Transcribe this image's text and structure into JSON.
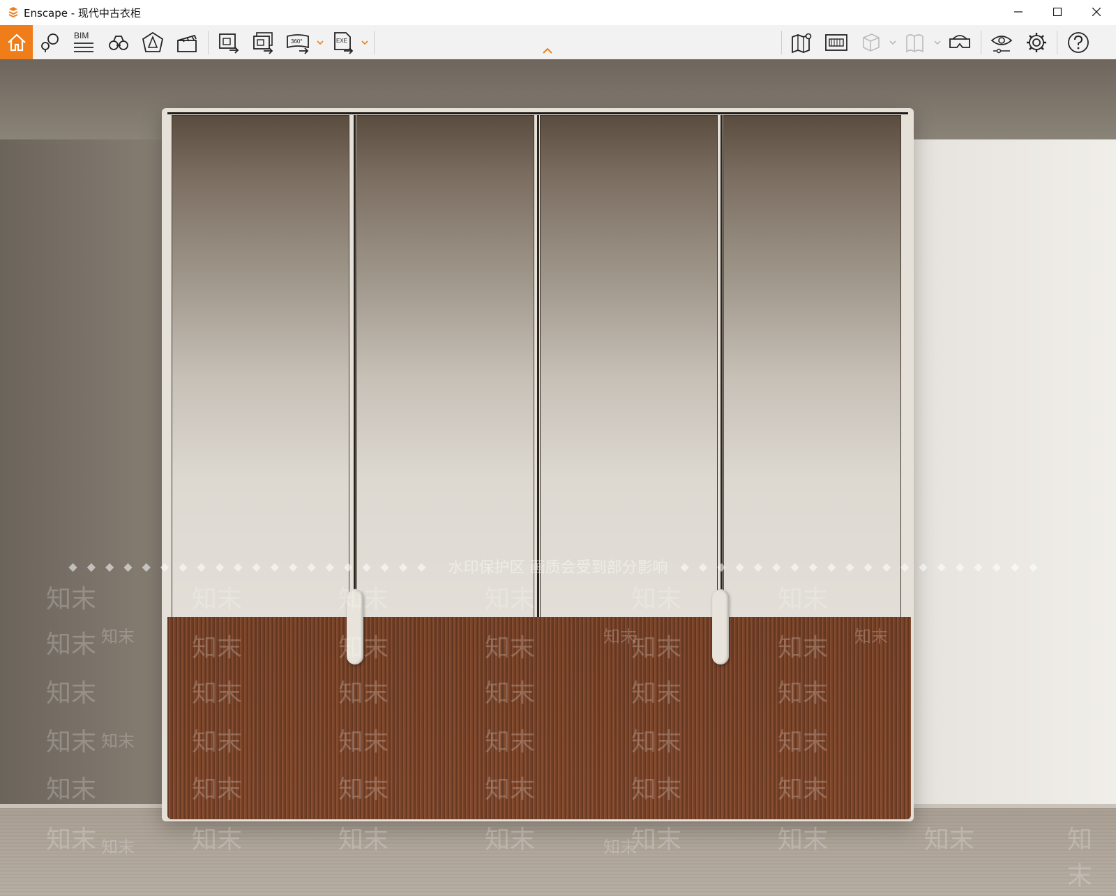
{
  "window": {
    "title": "Enscape - 现代中古衣柜",
    "controls": [
      "minimize",
      "maximize",
      "close"
    ]
  },
  "toolbar": {
    "left": [
      {
        "id": "home",
        "icon": "home-icon",
        "active": true
      },
      {
        "id": "views",
        "icon": "views-icon"
      },
      {
        "id": "bim",
        "icon": "bim-icon",
        "label": "BIM"
      },
      {
        "id": "binoculars",
        "icon": "binoculars-icon"
      },
      {
        "id": "asset-library",
        "icon": "asset-library-icon"
      },
      {
        "id": "video-editor",
        "icon": "clapper-icon"
      },
      {
        "id": "screenshot",
        "icon": "screenshot-icon"
      },
      {
        "id": "batch-render",
        "icon": "batch-render-icon"
      },
      {
        "id": "panorama",
        "icon": "panorama-icon",
        "label": "360°"
      },
      {
        "id": "export-exe",
        "icon": "export-exe-icon",
        "label": "EXE"
      }
    ],
    "right": [
      {
        "id": "map",
        "icon": "map-icon"
      },
      {
        "id": "batch",
        "icon": "batch-icon"
      },
      {
        "id": "cube",
        "icon": "cube-icon",
        "disabled": true
      },
      {
        "id": "book",
        "icon": "book-icon",
        "disabled": true
      },
      {
        "id": "vr",
        "icon": "vr-headset-icon"
      },
      {
        "id": "visual-settings",
        "icon": "eye-settings-icon"
      },
      {
        "id": "settings",
        "icon": "gear-icon"
      },
      {
        "id": "help",
        "icon": "help-icon"
      }
    ],
    "accent": "#ef7d1a"
  },
  "viewport": {
    "watermark_banner": "水印保护区   画质会受到部分影响",
    "watermark_mark": "知末",
    "diamonds": "◆◆◆◆◆◆◆◆◆◆◆◆◆◆◆◆◆◆◆◆"
  }
}
